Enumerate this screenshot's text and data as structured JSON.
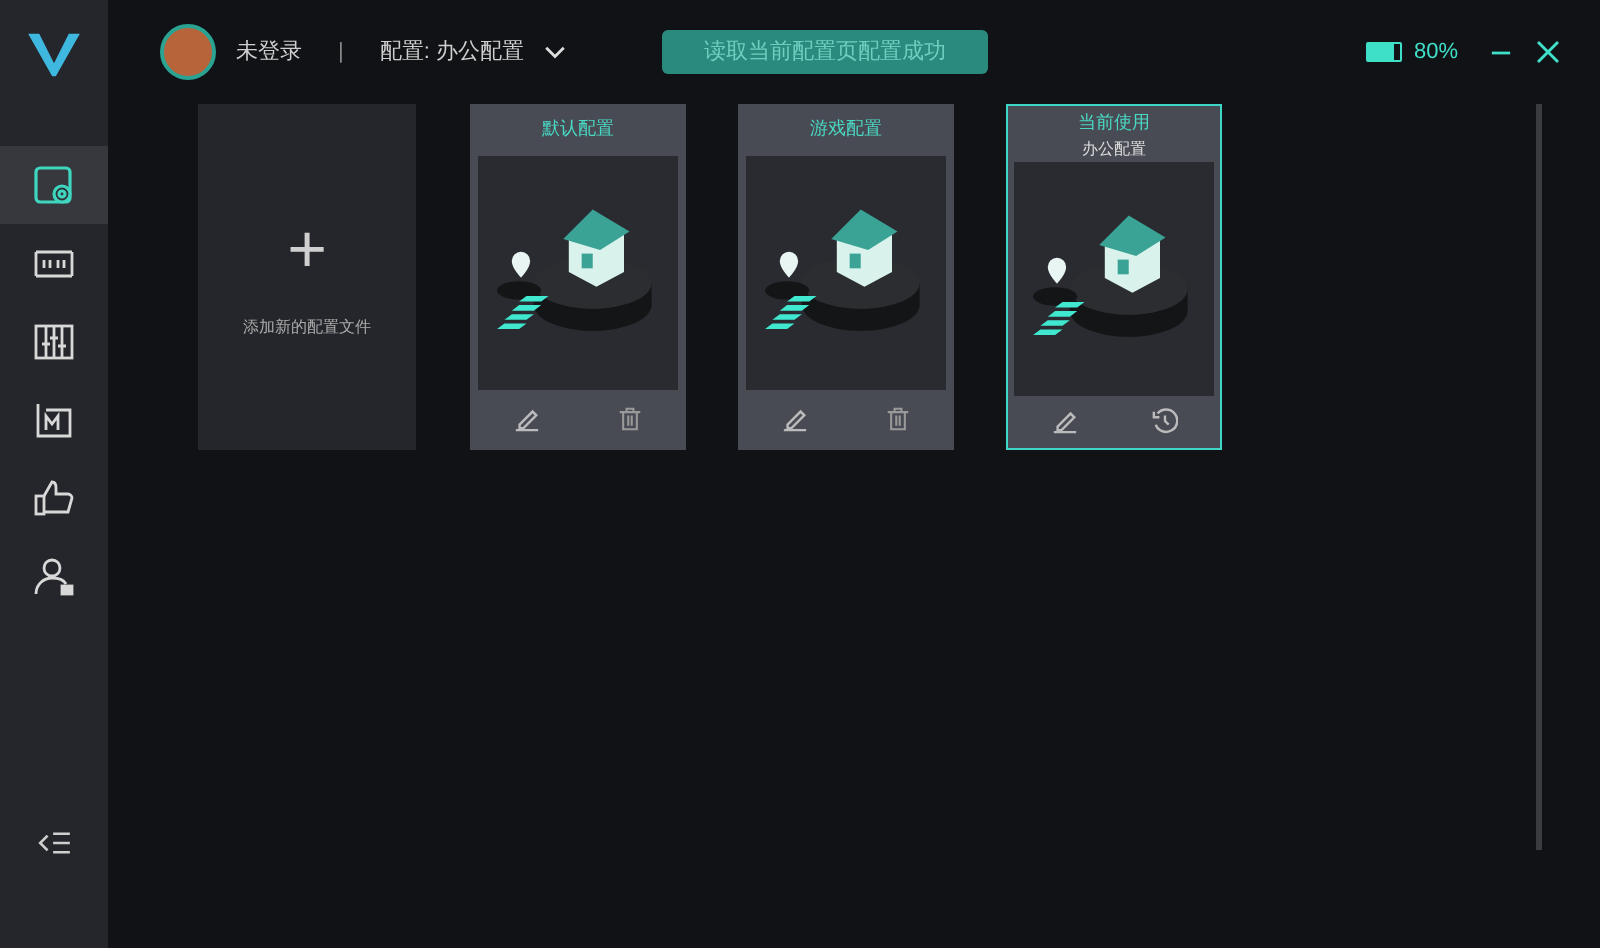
{
  "sidebar": {
    "items": [
      {
        "kind": "profile",
        "selected": true
      },
      {
        "kind": "dpi",
        "selected": false
      },
      {
        "kind": "equalizer",
        "selected": false
      },
      {
        "kind": "macro",
        "selected": false
      },
      {
        "kind": "like",
        "selected": false
      },
      {
        "kind": "account",
        "selected": false
      }
    ]
  },
  "header": {
    "user": "未登录",
    "separator": "|",
    "profile": "配置: 办公配置",
    "toast": "读取当前配置页配置成功",
    "battery": {
      "reading": "80%",
      "level": 0.8
    }
  },
  "add_card": {
    "icon": "+",
    "label": "添加新的配置文件"
  },
  "profiles": [
    {
      "title": "默认配置",
      "active": false,
      "kind": "deletable"
    },
    {
      "title": "游戏配置",
      "active": false,
      "kind": "deletable"
    },
    {
      "title": "当前使用",
      "subtitle": "办公配置",
      "active": true,
      "kind": "current"
    }
  ]
}
